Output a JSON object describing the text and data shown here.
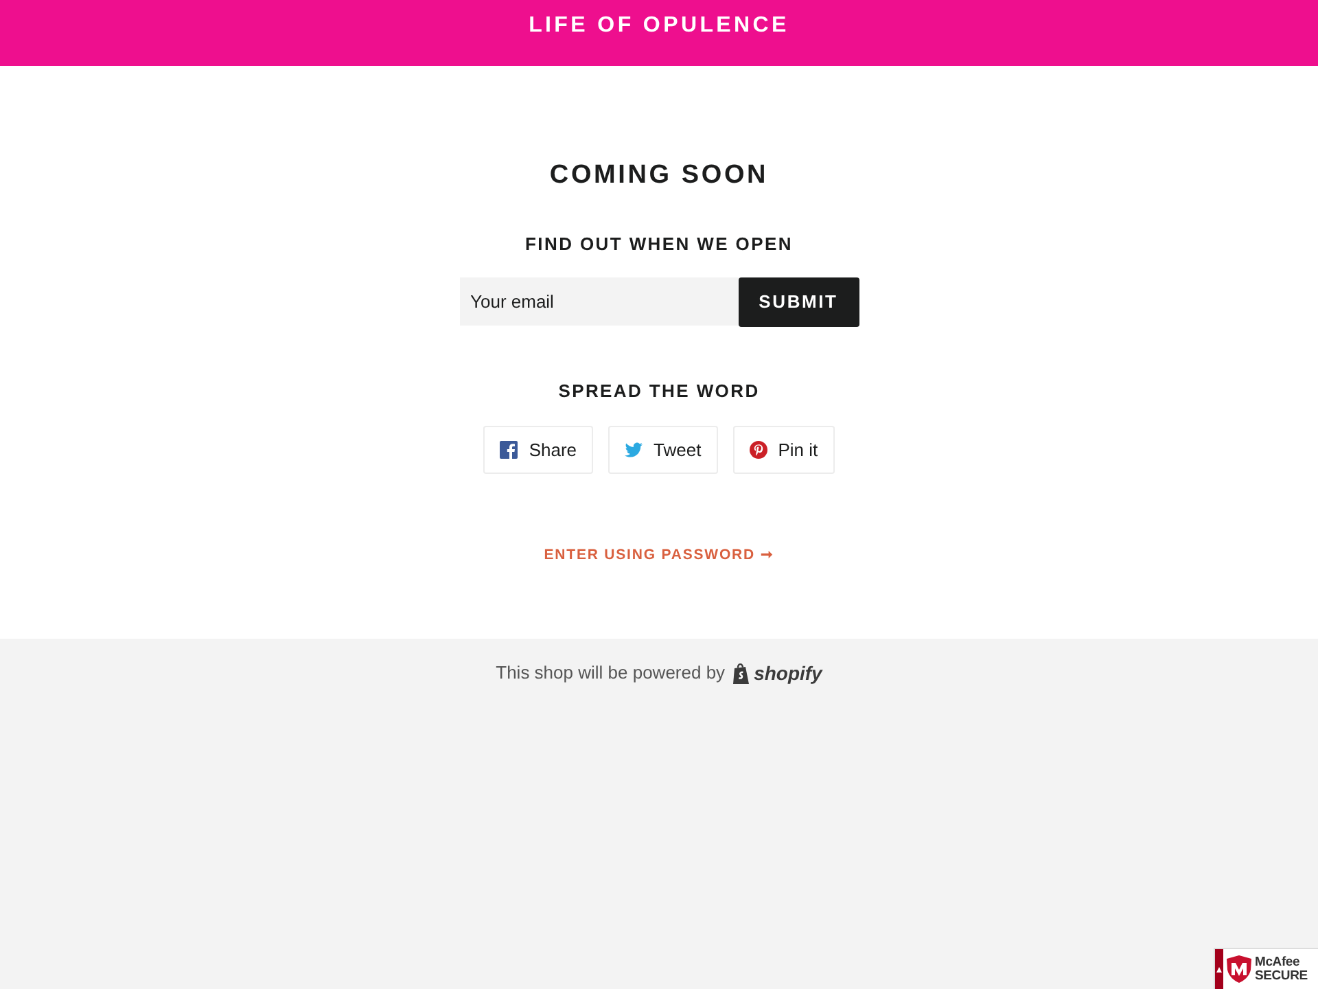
{
  "header": {
    "title": "LIFE OF OPULENCE"
  },
  "main": {
    "heading": "COMING SOON",
    "signup": {
      "heading": "FIND OUT WHEN WE OPEN",
      "email": {
        "placeholder": "Your email"
      },
      "button": "SUBMIT"
    },
    "share": {
      "heading": "SPREAD THE WORD",
      "buttons": [
        {
          "kind": "facebook",
          "label": "Share"
        },
        {
          "kind": "twitter",
          "label": "Tweet"
        },
        {
          "kind": "pinterest",
          "label": "Pin it"
        }
      ]
    },
    "password_link": "ENTER USING PASSWORD ➞"
  },
  "footer": {
    "text": "This shop will be powered by",
    "brand": "shopify"
  },
  "badge": {
    "line_1": "McAfee",
    "line_2": "SECURE"
  }
}
